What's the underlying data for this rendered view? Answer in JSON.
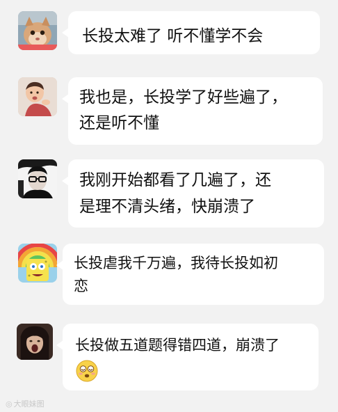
{
  "messages": [
    {
      "id": "msg-1",
      "avatar_icon": "cat-avatar",
      "lines": [
        "长投太难了 听不懂学不会"
      ]
    },
    {
      "id": "msg-2",
      "avatar_icon": "baby-avatar",
      "lines": [
        "我也是，长投学了好些遍了，",
        "还是听不懂"
      ]
    },
    {
      "id": "msg-3",
      "avatar_icon": "man-glasses-avatar",
      "lines": [
        "我刚开始都看了几遍了，还",
        "是理不清头绪，快崩溃了"
      ]
    },
    {
      "id": "msg-4",
      "avatar_icon": "spongebob-rainbow-avatar",
      "lines": [
        "长投虐我千万遍，我待长投如初",
        "恋"
      ]
    },
    {
      "id": "msg-5",
      "avatar_icon": "screaming-face-avatar",
      "lines": [
        "长投做五道题得错四道，崩溃了"
      ],
      "emoji": "dizzy-face-emoji"
    }
  ],
  "watermark": {
    "icon": "weibo-icon",
    "text": "大眼妹图"
  },
  "colors": {
    "background": "#f2f2f2",
    "bubble": "#ffffff",
    "text": "#111111",
    "watermark": "#c8c8c8"
  }
}
